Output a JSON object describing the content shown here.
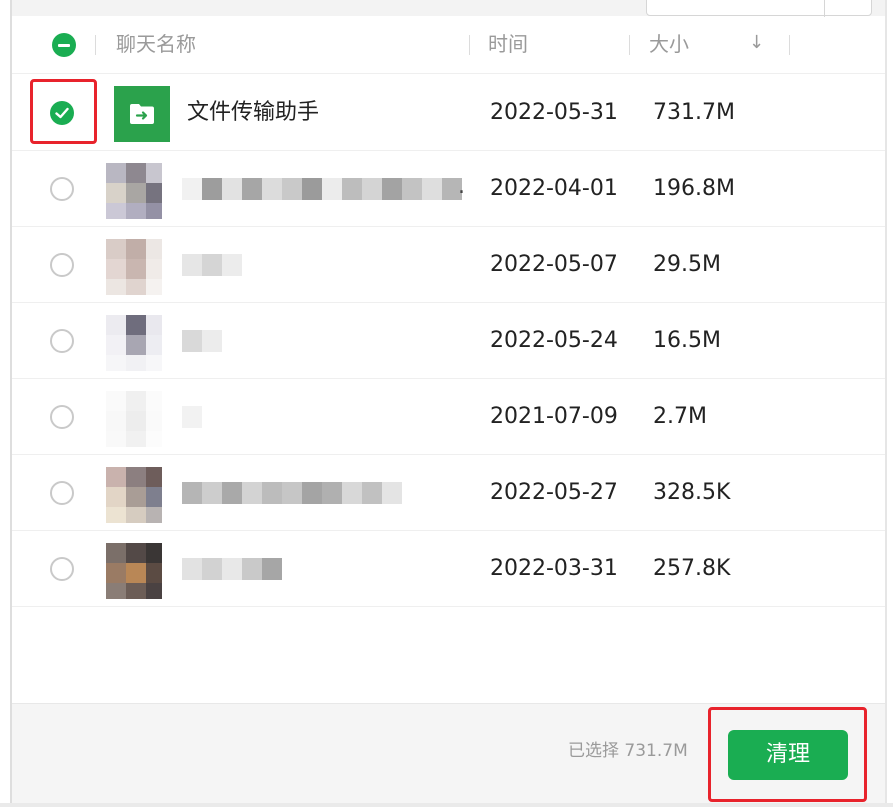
{
  "header": {
    "name_label": "聊天名称",
    "time_label": "时间",
    "size_label": "大小",
    "sort_icon": "arrow-down-icon"
  },
  "rows": [
    {
      "name": "文件传输助手",
      "date": "2022-05-31",
      "size": "731.7M",
      "checked": true,
      "avatar": "file-transfer-icon"
    },
    {
      "name": "",
      "date": "2022-04-01",
      "size": "196.8M",
      "checked": false,
      "avatar": "blurred-avatar"
    },
    {
      "name": "",
      "date": "2022-05-07",
      "size": "29.5M",
      "checked": false,
      "avatar": "blurred-avatar"
    },
    {
      "name": "",
      "date": "2022-05-24",
      "size": "16.5M",
      "checked": false,
      "avatar": "blurred-avatar"
    },
    {
      "name": "",
      "date": "2021-07-09",
      "size": "2.7M",
      "checked": false,
      "avatar": "blurred-avatar"
    },
    {
      "name": "",
      "date": "2022-05-27",
      "size": "328.5K",
      "checked": false,
      "avatar": "blurred-avatar"
    },
    {
      "name": "",
      "date": "2022-03-31",
      "size": "257.8K",
      "checked": false,
      "avatar": "blurred-avatar"
    }
  ],
  "footer": {
    "selected_text": "已选择 731.7M",
    "clean_label": "清理"
  },
  "colors": {
    "accent": "#1aad52",
    "highlight": "#e8232c"
  }
}
